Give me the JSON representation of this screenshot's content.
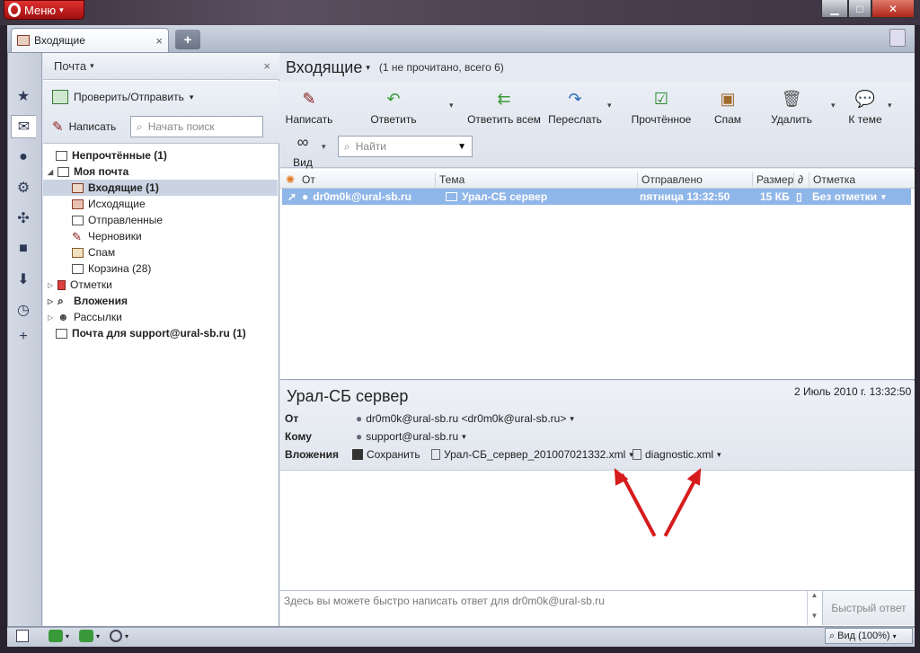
{
  "window": {
    "menu_label": "Меню",
    "min": "▁",
    "max": "□",
    "close": "✕"
  },
  "tab": {
    "title": "Входящие",
    "close": "×",
    "new_tab": "+"
  },
  "panel": {
    "title": "Почта",
    "close": "×",
    "check_send": "Проверить/Отправить",
    "compose": "Написать",
    "search_placeholder": "Начать поиск",
    "tree": [
      {
        "label": "Непрочтённые (1)",
        "bold": true
      },
      {
        "label": "Моя почта",
        "bold": true
      },
      {
        "label": "Входящие (1)",
        "bold": true
      },
      {
        "label": "Исходящие"
      },
      {
        "label": "Отправленные"
      },
      {
        "label": "Черновики"
      },
      {
        "label": "Спам"
      },
      {
        "label": "Корзина (28)"
      },
      {
        "label": "Отметки"
      },
      {
        "label": "Вложения",
        "bold": true
      },
      {
        "label": "Рассылки"
      },
      {
        "label": "Почта для support@ural-sb.ru (1)",
        "bold": true
      }
    ]
  },
  "main": {
    "title": "Входящие",
    "subtitle": "(1 не прочитано, всего 6)",
    "toolbar": {
      "compose": "Написать",
      "reply": "Ответить",
      "reply_all": "Ответить всем",
      "forward": "Переслать",
      "read": "Прочтённое",
      "spam": "Спам",
      "delete": "Удалить",
      "to_topic": "К теме",
      "view": "Вид",
      "find_placeholder": "Найти"
    },
    "columns": {
      "from": "От",
      "subject": "Тема",
      "sent": "Отправлено",
      "size": "Размер",
      "mark": "Отметка"
    },
    "messages": [
      {
        "from": "dr0m0k@ural-sb.ru",
        "subject": "Урал-СБ сервер",
        "sent": "пятница 13:32:50",
        "size": "15 КБ",
        "mark": "Без отметки"
      }
    ]
  },
  "preview": {
    "subject": "Урал-СБ сервер",
    "date": "2 Июль 2010 г. 13:32:50",
    "from_label": "От",
    "from_value": "dr0m0k@ural-sb.ru <dr0m0k@ural-sb.ru>",
    "to_label": "Кому",
    "to_value": "support@ural-sb.ru",
    "attach_label": "Вложения",
    "save": "Сохранить",
    "attachments": [
      "Урал-СБ_сервер_201007021332.xml",
      "diagnostic.xml"
    ]
  },
  "quick_reply": {
    "placeholder": "Здесь вы можете быстро написать ответ для dr0m0k@ural-sb.ru",
    "button": "Быстрый ответ"
  },
  "status": {
    "zoom": "Вид (100%)"
  },
  "colors": {
    "accent": "#8fb6e8",
    "menu": "#c81e1e",
    "arrow": "#d61c1c"
  }
}
